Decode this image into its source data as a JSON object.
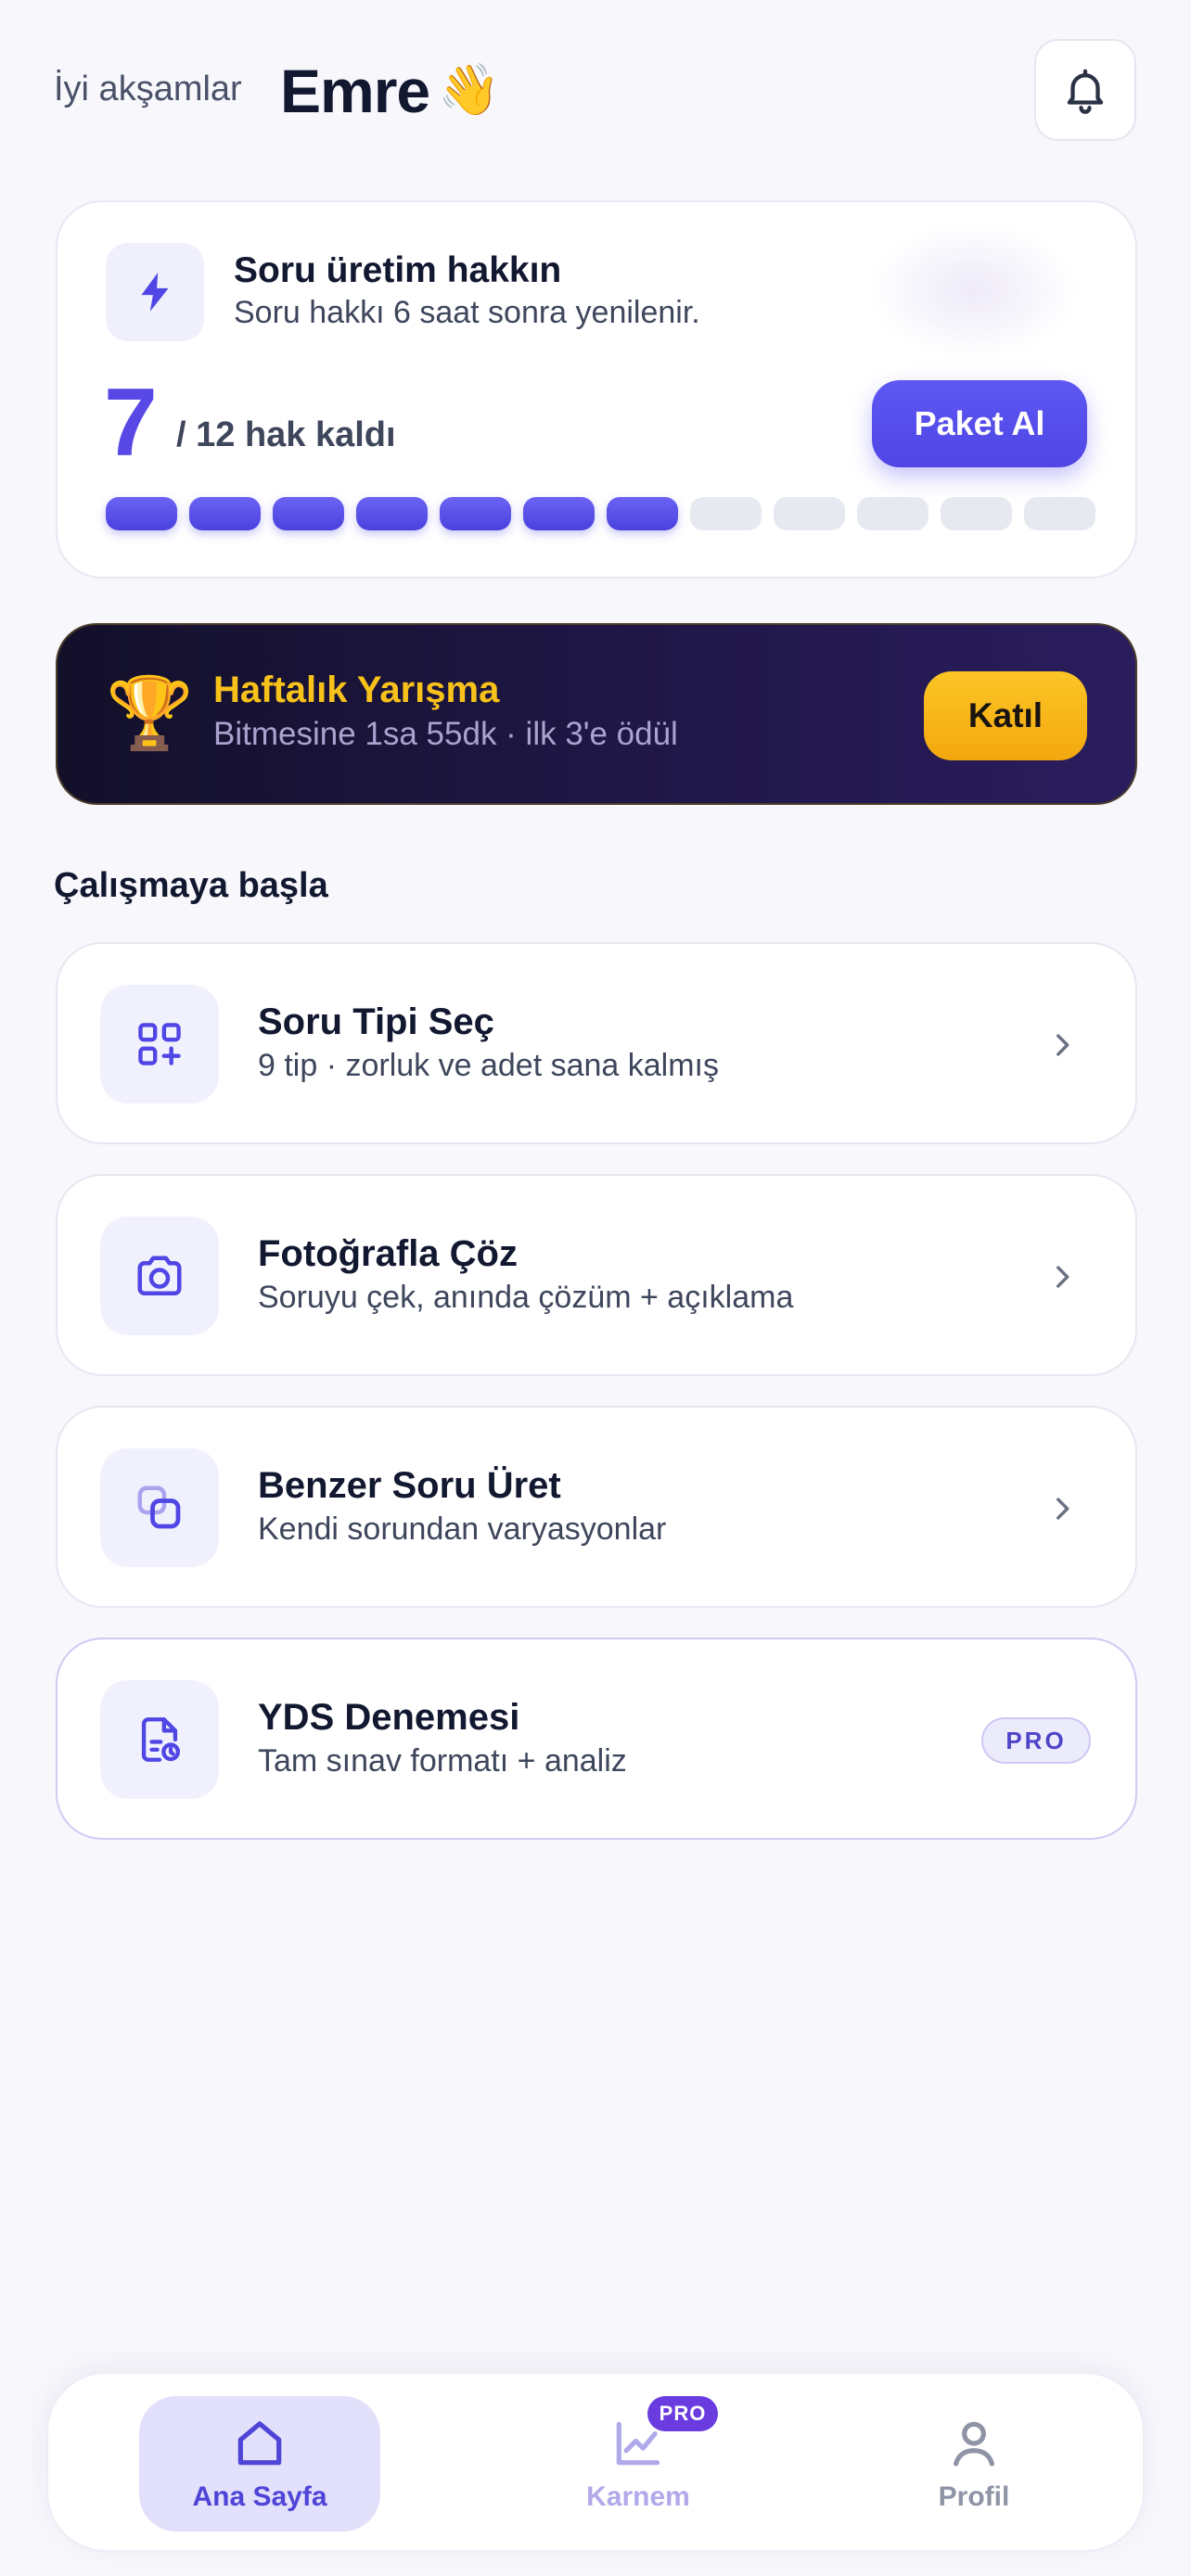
{
  "header": {
    "greeting": "İyi akşamlar",
    "username": "Emre",
    "wave_emoji": "👋",
    "bell_icon": "bell-icon"
  },
  "quota": {
    "title": "Soru üretim hakkın",
    "subtitle": "Soru hakkı 6 saat sonra yenilenir.",
    "remaining": "7",
    "total_text": "/ 12 hak kaldı",
    "remaining_value": 7,
    "total_value": 12,
    "buy_label": "Paket Al",
    "accent": "#5849e6"
  },
  "competition": {
    "trophy": "🏆",
    "title": "Haftalık Yarışma",
    "subtitle": "Bitmesine 1sa 55dk · ilk 3'e ödül",
    "join_label": "Katıl",
    "accent": "#f8c21b"
  },
  "section_title": "Çalışmaya başla",
  "actions": [
    {
      "title": "Soru Tipi Seç",
      "subtitle": "9 tip · zorluk ve adet sana kalmış",
      "icon": "grid-plus-icon"
    },
    {
      "title": "Fotoğrafla Çöz",
      "subtitle": "Soruyu çek, anında çözüm + açıklama",
      "icon": "camera-icon"
    },
    {
      "title": "Benzer Soru Üret",
      "subtitle": "Kendi sorundan varyasyonlar",
      "icon": "copy-icon"
    },
    {
      "title": "YDS Denemesi",
      "subtitle": "Tam sınav formatı + analiz",
      "icon": "exam-file-icon",
      "badge": "PRO"
    }
  ],
  "nav": {
    "home": "Ana Sayfa",
    "karnem": "Karnem",
    "karnem_badge": "PRO",
    "profil": "Profil"
  }
}
